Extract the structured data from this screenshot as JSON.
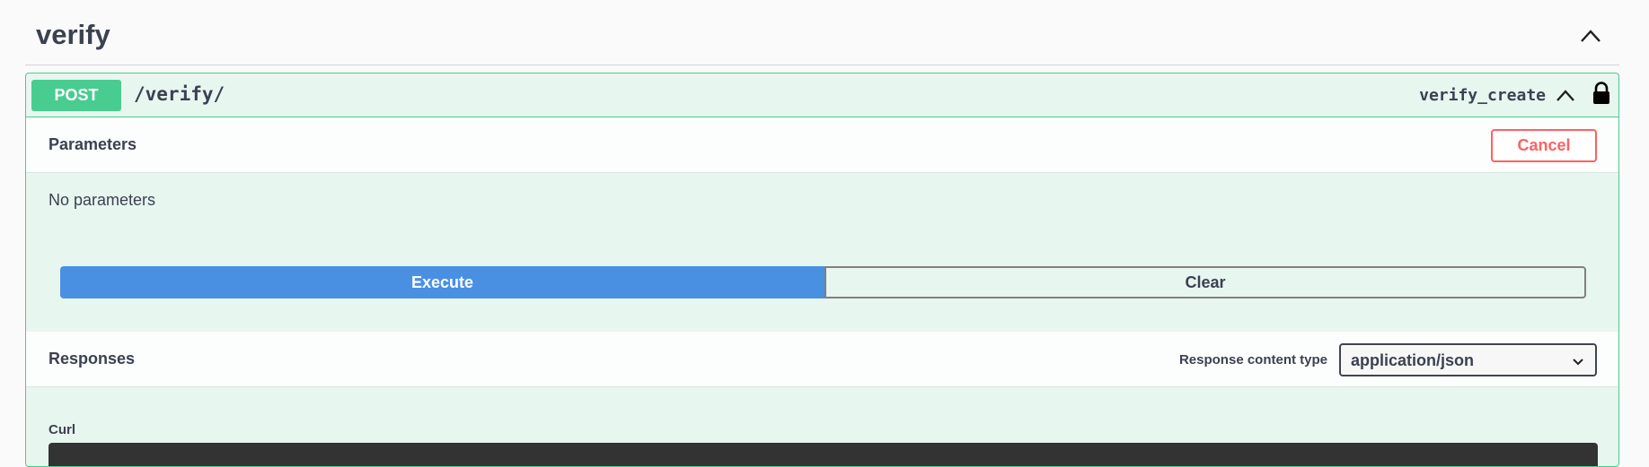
{
  "tag": {
    "title": "verify",
    "toggle_icon": "chevron-up-icon"
  },
  "operation": {
    "method": "POST",
    "path": "/verify/",
    "operation_id": "verify_create",
    "toggle_icon": "chevron-up-icon",
    "lock_icon": "lock-icon",
    "method_color": "#49cc90"
  },
  "parameters": {
    "title": "Parameters",
    "cancel_label": "Cancel",
    "empty_text": "No parameters"
  },
  "actions": {
    "execute_label": "Execute",
    "clear_label": "Clear",
    "execute_color": "#4990e2"
  },
  "responses": {
    "title": "Responses",
    "content_type_label": "Response content type",
    "content_type_value": "application/json",
    "curl_label": "Curl"
  },
  "colors": {
    "cancel": "#ff6060",
    "post_bg": "#e8f6f0"
  }
}
